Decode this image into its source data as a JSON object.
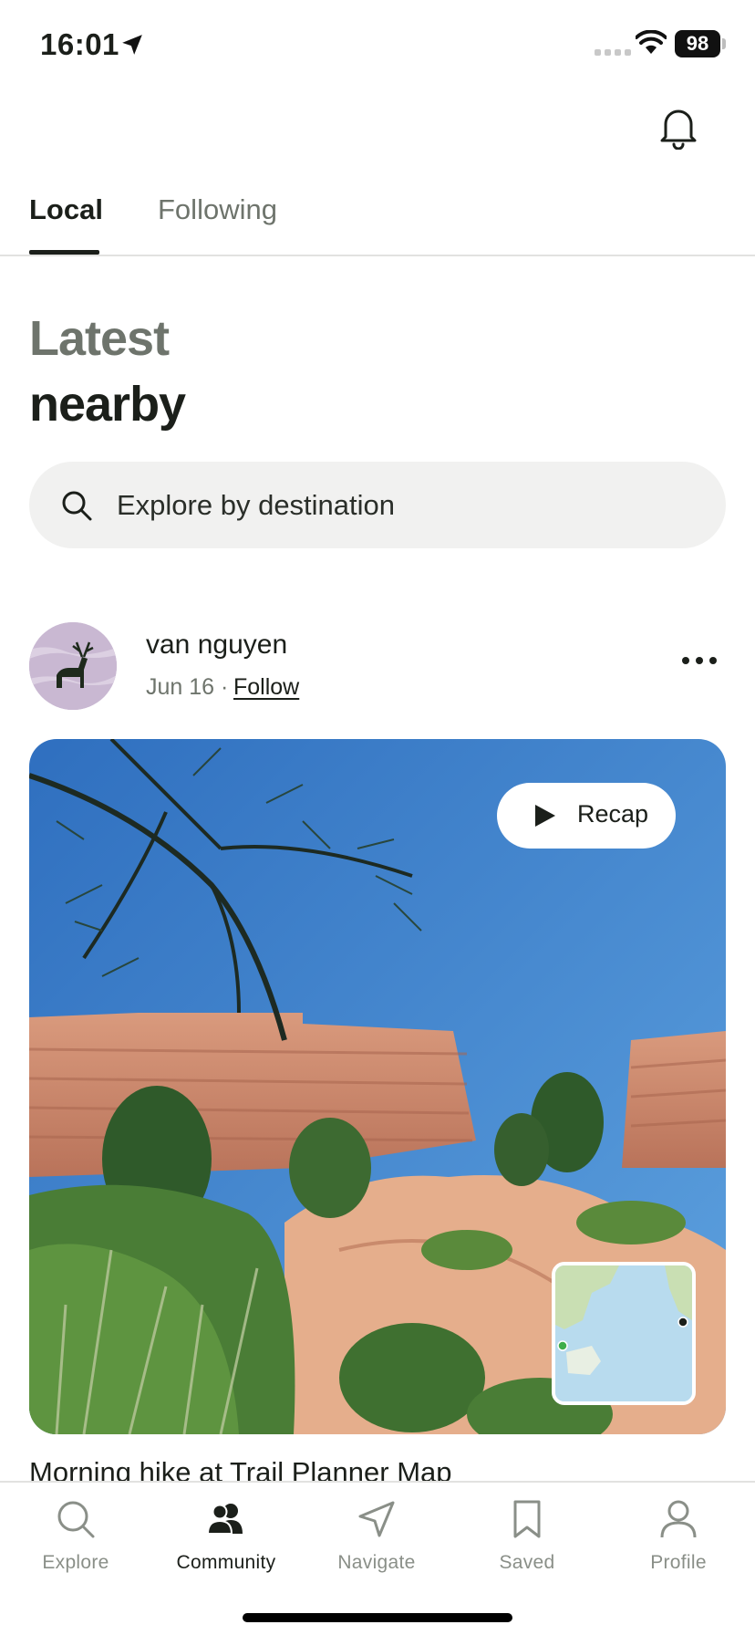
{
  "status_bar": {
    "time": "16:01",
    "battery": "98"
  },
  "tabs": [
    {
      "label": "Local",
      "active": true
    },
    {
      "label": "Following",
      "active": false
    }
  ],
  "heading": {
    "line1": "Latest",
    "line2": "nearby"
  },
  "search": {
    "placeholder": "Explore by destination",
    "value": ""
  },
  "post": {
    "author": "van nguyen",
    "date": "Jun 16 ·",
    "follow_label": "Follow",
    "recap_label": "Recap",
    "title": "Morning hike at Trail Planner Map"
  },
  "bottom_nav": [
    {
      "label": "Explore",
      "icon": "search-icon",
      "active": false
    },
    {
      "label": "Community",
      "icon": "community-icon",
      "active": true
    },
    {
      "label": "Navigate",
      "icon": "navigate-icon",
      "active": false
    },
    {
      "label": "Saved",
      "icon": "bookmark-icon",
      "active": false
    },
    {
      "label": "Profile",
      "icon": "profile-icon",
      "active": false
    }
  ],
  "colors": {
    "text": "#1b1f1a",
    "muted": "#6e746c",
    "search_bg": "#f1f1f0",
    "active_tab": "#1b1f1a"
  }
}
